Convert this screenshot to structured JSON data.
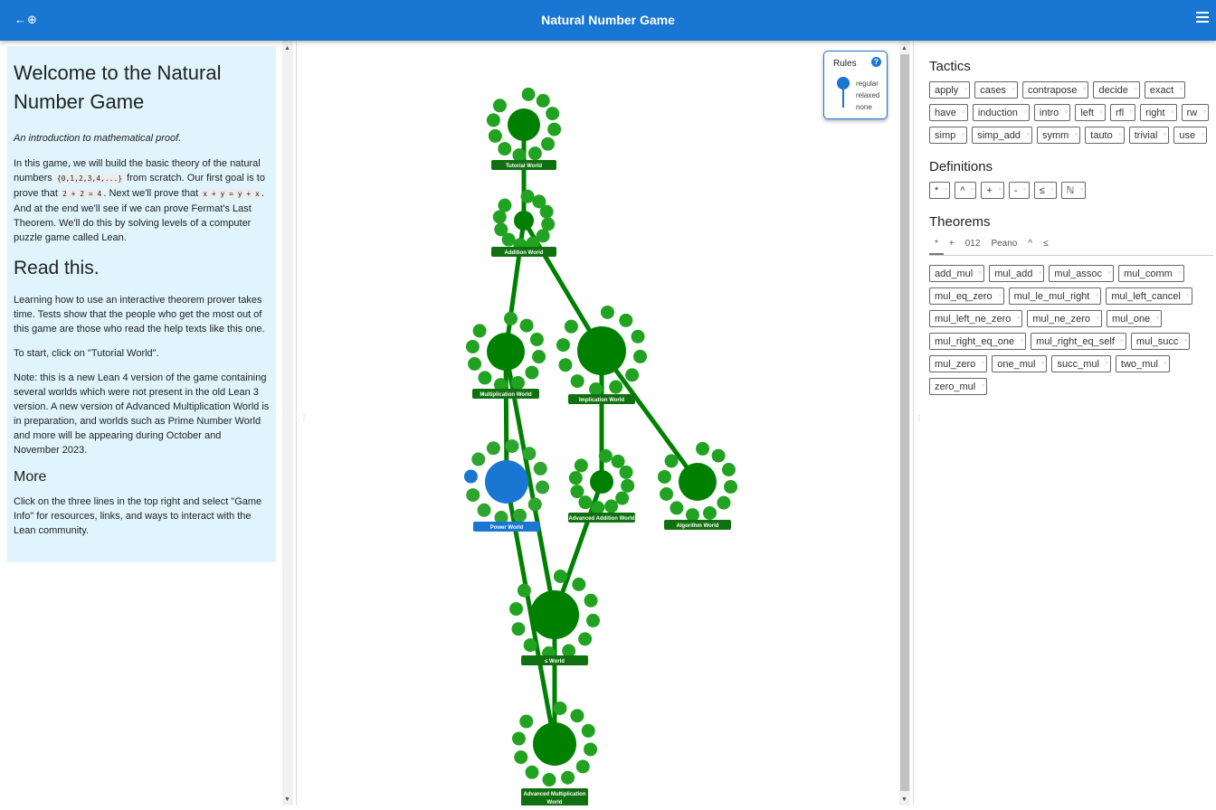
{
  "header": {
    "title": "Natural Number Game",
    "nav_glyph": "←⊕"
  },
  "intro": {
    "title": "Welcome to the Natural Number Game",
    "subtitle": "An introduction to mathematical proof.",
    "p1_a": "In this game, we will build the basic theory of the natural numbers ",
    "p1_code1": "{0,1,2,3,4,...}",
    "p1_b": " from scratch. Our first goal is to prove that ",
    "p1_code2": "2 + 2 = 4",
    "p1_c": ". Next we'll prove that ",
    "p1_code3": "x + y = y + x",
    "p1_d": ". And at the end we'll see if we can prove Fermat's Last Theorem. We'll do this by solving levels of a computer puzzle game called Lean.",
    "read_heading": "Read this.",
    "p2": "Learning how to use an interactive theorem prover takes time. Tests show that the people who get the most out of this game are those who read the help texts like this one.",
    "p3": "To start, click on \"Tutorial World\".",
    "p4": "Note: this is a new Lean 4 version of the game containing several worlds which were not present in the old Lean 3 version. A new version of Advanced Multiplication World is in preparation, and worlds such as Prime Number World and more will be appearing during October and November 2023.",
    "more_heading": "More",
    "p5": "Click on the three lines in the top right and select \"Game Info\" for resources, links, and ways to interact with the Lean community."
  },
  "rules": {
    "label": "Rules",
    "help": "?",
    "options": [
      "regular",
      "relaxed",
      "none"
    ],
    "selected": "regular"
  },
  "worlds": [
    {
      "id": "tutorial",
      "label": "Tutorial World",
      "color": "#008000"
    },
    {
      "id": "addition",
      "label": "Addition World",
      "color": "#008000"
    },
    {
      "id": "multiplication",
      "label": "Multiplication World",
      "color": "#008000"
    },
    {
      "id": "implication",
      "label": "Implication World",
      "color": "#008000"
    },
    {
      "id": "power",
      "label": "Power World",
      "color": "#1976d2"
    },
    {
      "id": "advaddition",
      "label": "Advanced Addition World",
      "color": "#008000"
    },
    {
      "id": "algorithm",
      "label": "Algorithm World",
      "color": "#008000"
    },
    {
      "id": "le",
      "label": "≤ World",
      "color": "#008000"
    },
    {
      "id": "advmult",
      "label": "Advanced Multiplication World",
      "color": "#008000"
    }
  ],
  "inventory": {
    "tactics_heading": "Tactics",
    "tactics": [
      "apply",
      "cases",
      "contrapose",
      "decide",
      "exact",
      "have",
      "induction",
      "intro",
      "left",
      "rfl",
      "right",
      "rw",
      "simp",
      "simp_add",
      "symm",
      "tauto",
      "trivial",
      "use"
    ],
    "definitions_heading": "Definitions",
    "definitions": [
      "*",
      "^",
      "+",
      "-",
      "≤",
      "ℕ"
    ],
    "theorems_heading": "Theorems",
    "theorem_tabs": [
      "*",
      "+",
      "012",
      "Peano",
      "^",
      "≤"
    ],
    "active_tab": "*",
    "theorems": [
      "add_mul",
      "mul_add",
      "mul_assoc",
      "mul_comm",
      "mul_eq_zero",
      "mul_le_mul_right",
      "mul_left_cancel",
      "mul_left_ne_zero",
      "mul_ne_zero",
      "mul_one",
      "mul_right_eq_one",
      "mul_right_eq_self",
      "mul_succ",
      "mul_zero",
      "one_mul",
      "succ_mul",
      "two_mul",
      "zero_mul"
    ]
  },
  "colors": {
    "accent": "#1976d2",
    "world": "#008000",
    "intro_bg": "#dff4fc"
  }
}
